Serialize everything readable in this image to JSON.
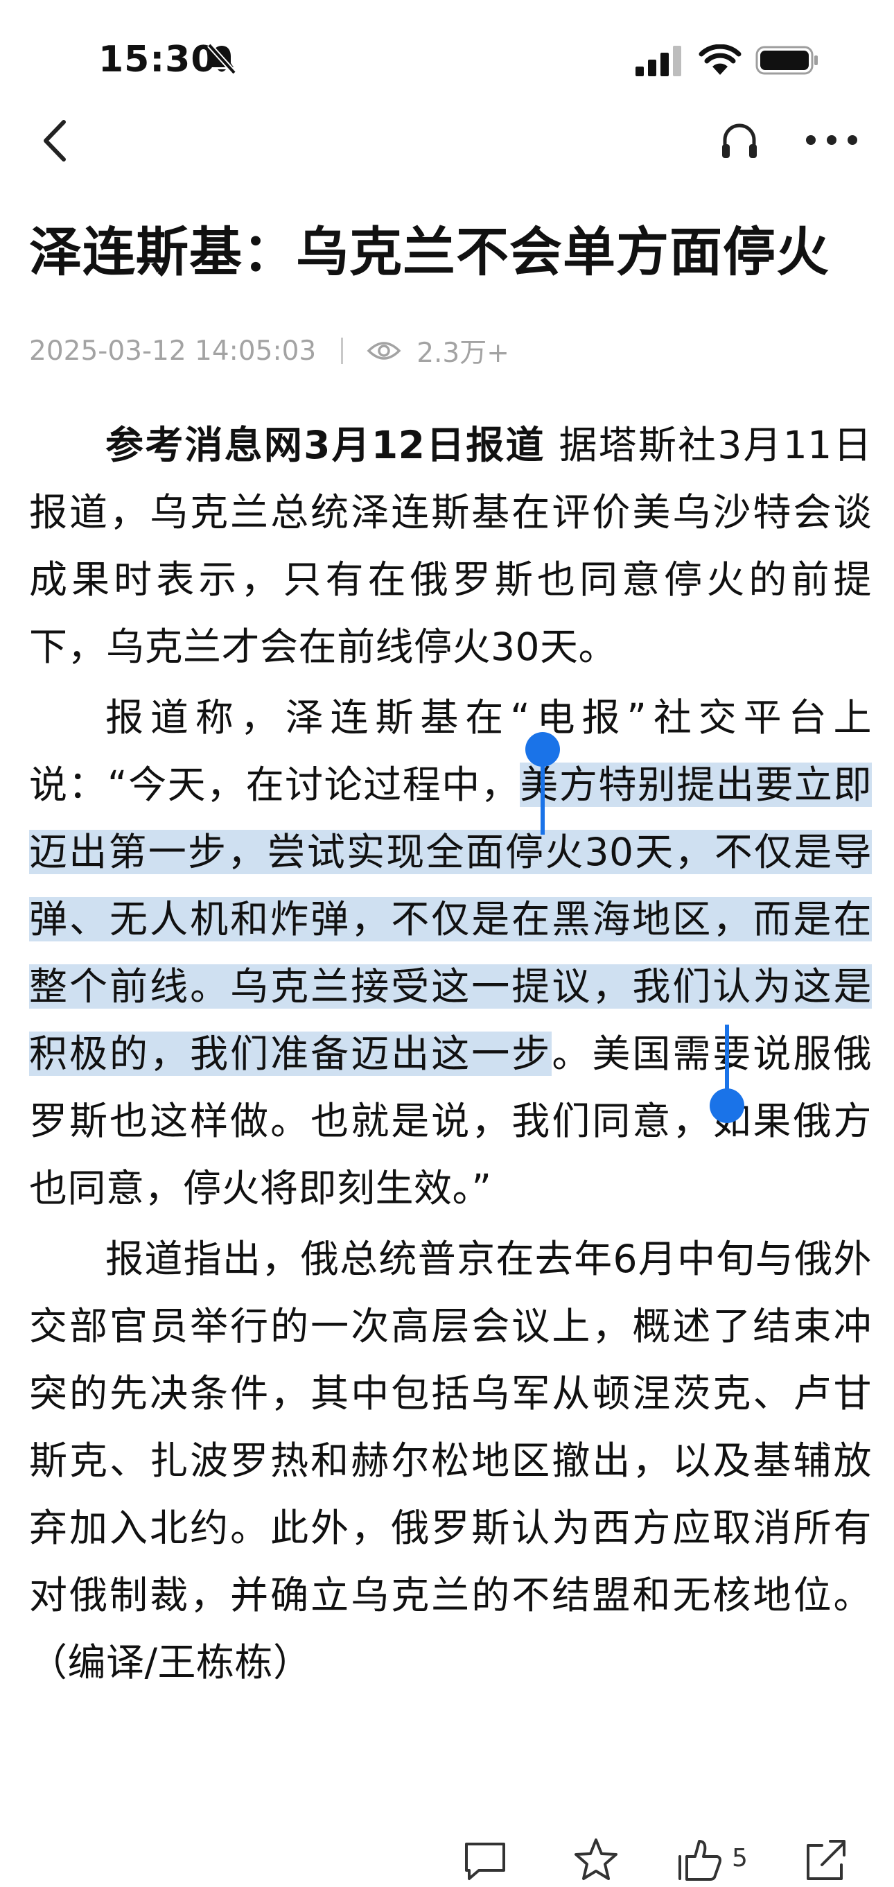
{
  "status_bar": {
    "time": "15:30",
    "icons": [
      "bell-slash-icon",
      "cellular-signal-icon",
      "wifi-icon",
      "battery-icon"
    ]
  },
  "nav": {
    "icons": [
      "back-chevron-icon",
      "headphones-icon",
      "more-dots-icon"
    ]
  },
  "article": {
    "title": "泽连斯基：乌克兰不会单方面停火",
    "datetime": "2025-03-12 14:05:03",
    "views": "2.3万+",
    "p1_lead": "参考消息网3月12日报道",
    "p1_body": " 据塔斯社3月11日报道，乌克兰总统泽连斯基在评价美乌沙特会谈成果时表示，只有在俄罗斯也同意停火的前提下，乌克兰才会在前线停火30天。",
    "p2_before": "报道称，泽连斯基在“电报”社交平台上说：“今天，在讨论过程中，",
    "p2_selected": "美方特别提出要立即迈出第一步，尝试实现全面停火30天，不仅是导弹、无人机和炸弹，不仅是在黑海地区，而是在整个前线。乌克兰接受这一提议，我们认为这是积极的，我们准备迈出这一步",
    "p2_after": "。美国需要说服俄罗斯也这样做。也就是说，我们同意，如果俄方也同意，停火将即刻生效。”",
    "p3": "报道指出，俄总统普京在去年6月中旬与俄外交部官员举行的一次高层会议上，概述了结束冲突的先决条件，其中包括乌军从顿涅茨克、卢甘斯克、扎波罗热和赫尔松地区撤出，以及基辅放弃加入北约。此外，俄罗斯认为西方应取消所有对俄制裁，并确立乌克兰的不结盟和无核地位。（编译/王栋栋）"
  },
  "toolbar": {
    "like_count": "5",
    "icons": [
      "comment-icon",
      "star-icon",
      "thumbs-up-icon",
      "share-icon"
    ]
  },
  "colors": {
    "selection": "#cfe0f1",
    "handle": "#1a73e8",
    "meta_text": "#a3a3a3"
  }
}
